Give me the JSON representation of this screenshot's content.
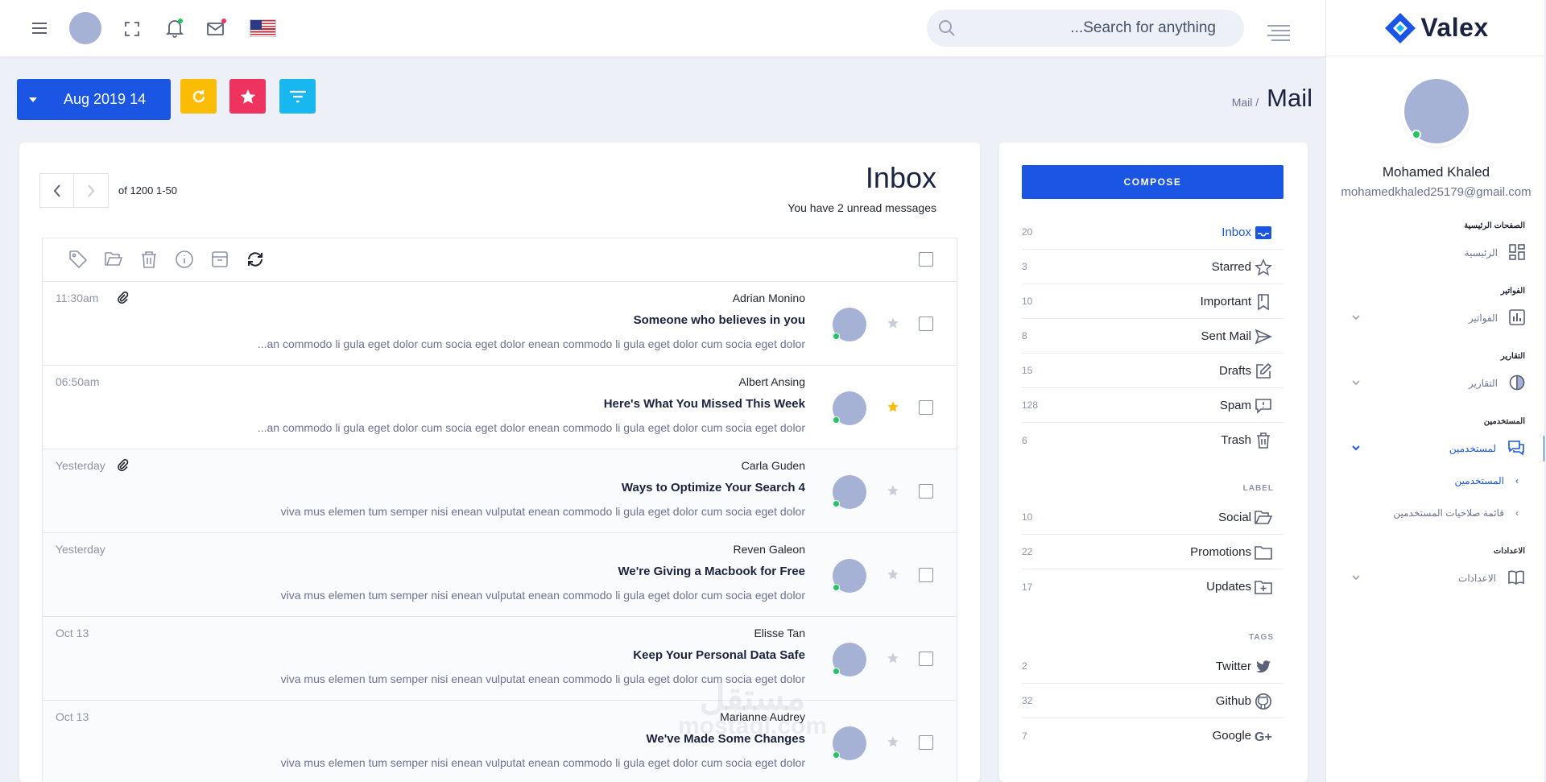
{
  "brand": {
    "name": "Valex"
  },
  "header": {
    "search_placeholder": "...Search for anything",
    "language_flag": "us-flag-icon"
  },
  "subheader": {
    "date_label": "Aug 2019 14",
    "breadcrumb_parent": "Mail /",
    "breadcrumb_current": "Mail"
  },
  "user": {
    "name": "Mohamed Khaled",
    "email": "mohamedkhaled25179@gmail.com"
  },
  "nav": {
    "sections": [
      {
        "title": "الصفحات الرئيسية",
        "item": "الرئيسية",
        "icon": "dashboard-icon"
      },
      {
        "title": "الفواتير",
        "item": "الفواتير",
        "icon": "bar-chart-icon"
      },
      {
        "title": "التقارير",
        "item": "التقارير",
        "icon": "pie-chart-icon"
      },
      {
        "title": "المستخدمين",
        "item": "لمستخدمين",
        "icon": "chat-icon"
      },
      {
        "title": "الاعدادات",
        "item": "الاعدادات",
        "icon": "book-icon"
      }
    ],
    "sub_items": [
      {
        "label": "المستخدمين"
      },
      {
        "label": "قائمة صلاحيات المستخدمين"
      }
    ]
  },
  "mail": {
    "title": "Inbox",
    "unread_text": "You have 2 unread messages",
    "pagination": "of 1200 1-50",
    "rows": [
      {
        "time": "11:30am",
        "sender": "Adrian Monino",
        "subject": "Someone who believes in you",
        "snippet": "...an commodo li gula eget dolor cum socia eget dolor enean commodo li gula eget dolor cum socia eget dolor",
        "attachment": true,
        "starred": false,
        "read": false
      },
      {
        "time": "06:50am",
        "sender": "Albert Ansing",
        "subject": "Here's What You Missed This Week",
        "snippet": "...an commodo li gula eget dolor cum socia eget dolor enean commodo li gula eget dolor cum socia eget dolor",
        "attachment": false,
        "starred": true,
        "read": false
      },
      {
        "time": "Yesterday",
        "sender": "Carla Guden",
        "subject": "Ways to Optimize Your Search 4",
        "snippet": "viva mus elemen tum semper nisi enean vulputat enean commodo li gula eget dolor cum socia eget dolor",
        "attachment": true,
        "starred": false,
        "read": true
      },
      {
        "time": "Yesterday",
        "sender": "Reven Galeon",
        "subject": "We're Giving a Macbook for Free",
        "snippet": "viva mus elemen tum semper nisi enean vulputat enean commodo li gula eget dolor cum socia eget dolor",
        "attachment": false,
        "starred": false,
        "read": true
      },
      {
        "time": "Oct 13",
        "sender": "Elisse Tan",
        "subject": "Keep Your Personal Data Safe",
        "snippet": "viva mus elemen tum semper nisi enean vulputat enean commodo li gula eget dolor cum socia eget dolor",
        "attachment": false,
        "starred": false,
        "read": true
      },
      {
        "time": "Oct 13",
        "sender": "Marianne Audrey",
        "subject": "We've Made Some Changes",
        "snippet": "viva mus elemen tum semper nisi enean vulputat enean commodo li gula eget dolor cum socia eget dolor",
        "attachment": false,
        "starred": false,
        "read": true
      }
    ]
  },
  "folders": {
    "compose_label": "COMPOSE",
    "items": [
      {
        "name": "Inbox",
        "count": "20",
        "icon": "inbox-icon"
      },
      {
        "name": "Starred",
        "count": "3",
        "icon": "star-icon"
      },
      {
        "name": "Important",
        "count": "10",
        "icon": "bookmark-icon"
      },
      {
        "name": "Sent Mail",
        "count": "8",
        "icon": "send-icon"
      },
      {
        "name": "Drafts",
        "count": "15",
        "icon": "edit-icon"
      },
      {
        "name": "Spam",
        "count": "128",
        "icon": "spam-icon"
      },
      {
        "name": "Trash",
        "count": "6",
        "icon": "trash-icon"
      }
    ],
    "label_title": "LABEL",
    "labels": [
      {
        "name": "Social",
        "count": "10",
        "icon": "folder-open-icon"
      },
      {
        "name": "Promotions",
        "count": "22",
        "icon": "folder-icon"
      },
      {
        "name": "Updates",
        "count": "17",
        "icon": "folder-plus-icon"
      }
    ],
    "tags_title": "TAGS",
    "tags": [
      {
        "name": "Twitter",
        "count": "2",
        "icon": "twitter-icon"
      },
      {
        "name": "Github",
        "count": "32",
        "icon": "github-icon"
      },
      {
        "name": "Google",
        "count": "7",
        "icon": "google-plus-icon"
      }
    ]
  },
  "watermark": {
    "line1": "مستقل",
    "line2": "mostaql.com"
  },
  "colors": {
    "primary": "#1a55e3",
    "warning": "#fbbc06",
    "danger": "#ee335e",
    "info": "#19b7f0",
    "avatar": "#a5b2d6",
    "online": "#22c55e"
  }
}
